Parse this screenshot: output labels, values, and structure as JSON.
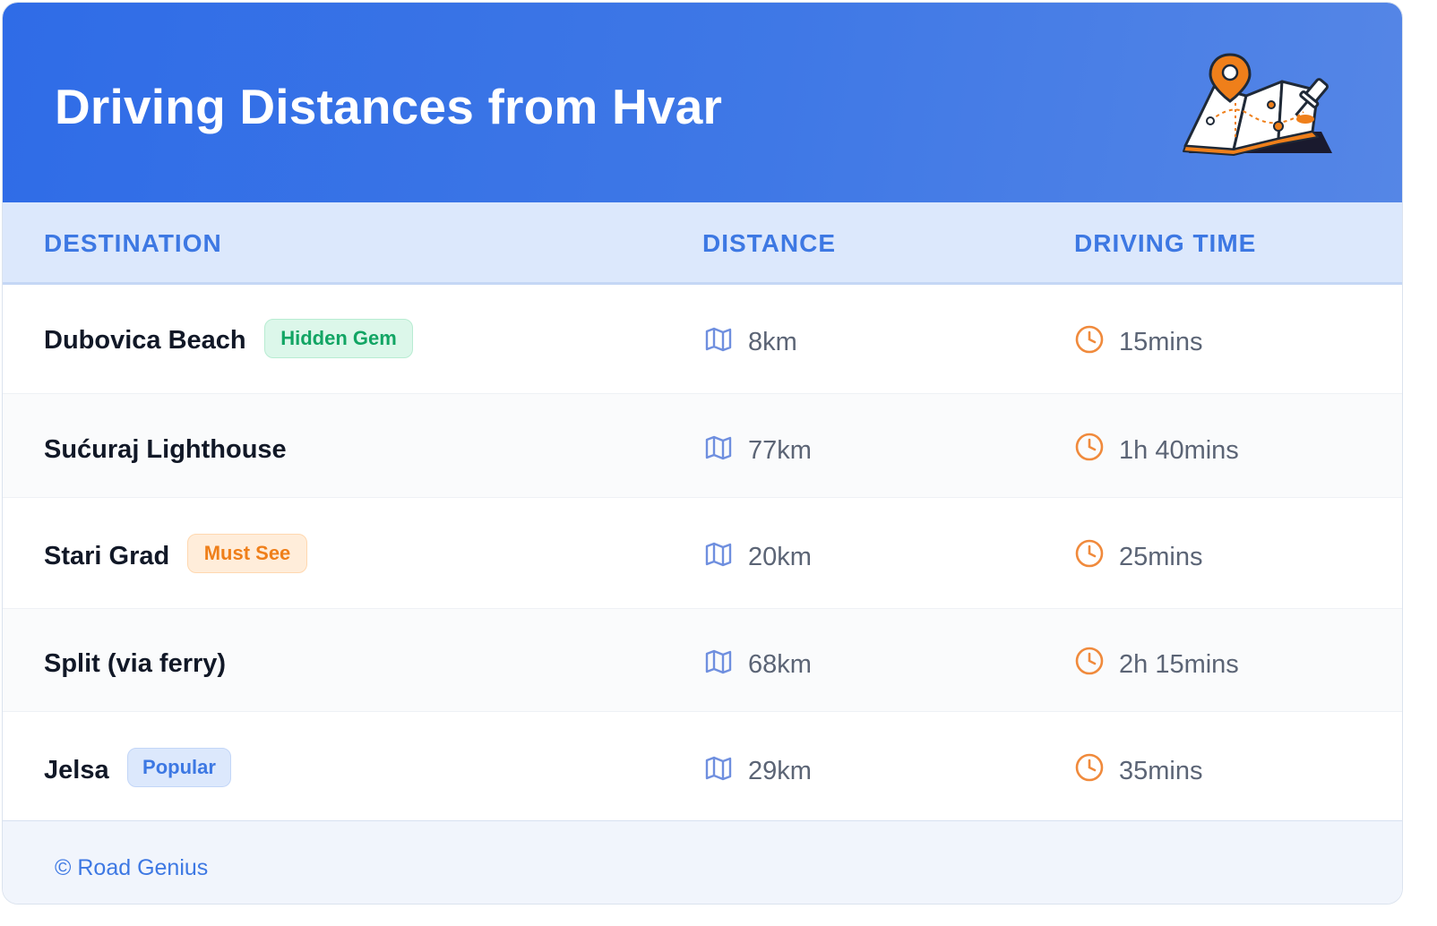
{
  "header": {
    "title": "Driving Distances from Hvar",
    "illustration": "map-with-pins-icon"
  },
  "columns": {
    "destination": "DESTINATION",
    "distance": "DISTANCE",
    "driving_time": "DRIVING TIME"
  },
  "rows": [
    {
      "destination": "Dubovica Beach",
      "badge": "Hidden Gem",
      "badge_color": "green",
      "distance": "8km",
      "time": "15mins"
    },
    {
      "destination": "Sućuraj Lighthouse",
      "badge": "",
      "badge_color": "",
      "distance": "77km",
      "time": "1h 40mins"
    },
    {
      "destination": "Stari Grad",
      "badge": "Must See",
      "badge_color": "orange",
      "distance": "20km",
      "time": "25mins"
    },
    {
      "destination": "Split (via ferry)",
      "badge": "",
      "badge_color": "",
      "distance": "68km",
      "time": "2h 15mins"
    },
    {
      "destination": "Jelsa",
      "badge": "Popular",
      "badge_color": "blue",
      "distance": "29km",
      "time": "35mins"
    }
  ],
  "icons": {
    "distance": "map-icon",
    "time": "clock-icon"
  },
  "colors": {
    "header_gradient_start": "#2f6ce7",
    "header_gradient_end": "#5586e6",
    "accent_blue": "#3d78e3",
    "accent_orange": "#f08a3c",
    "accent_green": "#12a564"
  },
  "footer": {
    "text": "© Road Genius"
  }
}
